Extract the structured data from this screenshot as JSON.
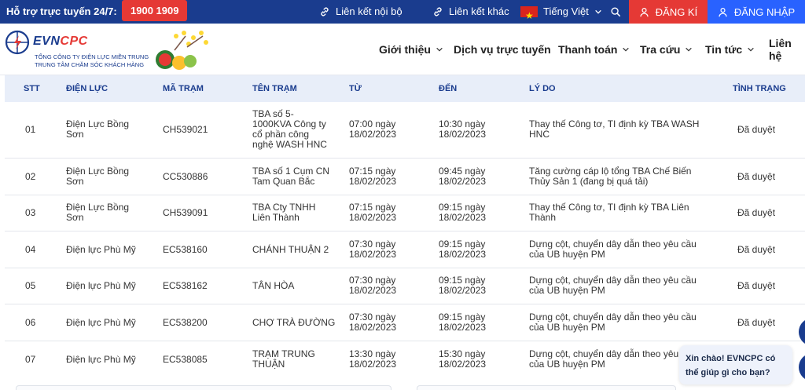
{
  "topbar": {
    "support_label": "Hỗ trợ trực tuyến 24/7:",
    "hotline": "1900 1909",
    "link_internal": "Liên kết nội bộ",
    "link_other": "Liên kết khác",
    "language": "Tiếng Việt",
    "register": "ĐĂNG KÍ",
    "login": "ĐĂNG NHẬP"
  },
  "brand": {
    "logo_ev": "EVN",
    "logo_cpc": "CPC",
    "sub1": "TỔNG CÔNG TY ĐIỆN LỰC MIỀN TRUNG",
    "sub2": "TRUNG TÂM CHĂM SÓC KHÁCH HÀNG"
  },
  "nav": {
    "intro": "Giới thiệu",
    "online": "Dịch vụ trực tuyến",
    "payment": "Thanh toán",
    "lookup": "Tra cứu",
    "news": "Tin tức",
    "contact": "Liên hệ"
  },
  "table": {
    "headers": {
      "stt": "STT",
      "dienluc": "ĐIỆN LỰC",
      "matram": "MÃ TRẠM",
      "tentram": "TÊN TRẠM",
      "tu": "TỪ",
      "den": "ĐẾN",
      "lydo": "LÝ DO",
      "tinhtrang": "TÌNH TRẠNG"
    },
    "rows": [
      {
        "stt": "01",
        "dl1": "Điện Lực Bồng",
        "dl2": "Sơn",
        "ma": "CH539021",
        "ten1": "TBA số 5-",
        "ten2": "1000KVA Công ty",
        "ten3": "cổ phần công",
        "ten4": "nghệ WASH HNC",
        "tu1": "07:00 ngày",
        "tu2": "18/02/2023",
        "den1": "10:30 ngày",
        "den2": "18/02/2023",
        "ly1": "Thay thế Công tơ, TI định kỳ TBA WASH",
        "ly2": "HNC",
        "tt": "Đã duyệt"
      },
      {
        "stt": "02",
        "dl1": "Điện Lực Bồng",
        "dl2": "Sơn",
        "ma": "CC530886",
        "ten1": "TBA số 1 Cụm CN",
        "ten2": "Tam Quan Bắc",
        "ten3": "",
        "ten4": "",
        "tu1": "07:15 ngày",
        "tu2": "18/02/2023",
        "den1": "09:45 ngày",
        "den2": "18/02/2023",
        "ly1": "Tăng cường cáp lộ tổng TBA Chế Biến",
        "ly2": "Thủy Sản 1 (đang bị quá tải)",
        "tt": "Đã duyệt"
      },
      {
        "stt": "03",
        "dl1": "Điện Lực Bồng",
        "dl2": "Sơn",
        "ma": "CH539091",
        "ten1": "TBA Cty TNHH",
        "ten2": "Liên Thành",
        "ten3": "",
        "ten4": "",
        "tu1": "07:15 ngày",
        "tu2": "18/02/2023",
        "den1": "09:15 ngày",
        "den2": "18/02/2023",
        "ly1": "Thay thế Công tơ, TI định kỳ TBA Liên",
        "ly2": "Thành",
        "tt": "Đã duyệt"
      },
      {
        "stt": "04",
        "dl1": "Điện lực Phù Mỹ",
        "dl2": "",
        "ma": "EC538160",
        "ten1": "CHÁNH THUẬN 2",
        "ten2": "",
        "ten3": "",
        "ten4": "",
        "tu1": "07:30 ngày",
        "tu2": "18/02/2023",
        "den1": "09:15 ngày",
        "den2": "18/02/2023",
        "ly1": "Dựng cột, chuyển dây dẫn theo yêu cầu",
        "ly2": "của UB huyện PM",
        "tt": "Đã duyệt"
      },
      {
        "stt": "05",
        "dl1": "Điện lực Phù Mỹ",
        "dl2": "",
        "ma": "EC538162",
        "ten1": "TÂN HÒA",
        "ten2": "",
        "ten3": "",
        "ten4": "",
        "tu1": "07:30 ngày",
        "tu2": "18/02/2023",
        "den1": "09:15 ngày",
        "den2": "18/02/2023",
        "ly1": "Dựng cột, chuyển dây dẫn theo yêu cầu",
        "ly2": "của UB huyện PM",
        "tt": "Đã duyệt"
      },
      {
        "stt": "06",
        "dl1": "Điện lực Phù Mỹ",
        "dl2": "",
        "ma": "EC538200",
        "ten1": "CHỢ TRÀ ĐƯỜNG",
        "ten2": "",
        "ten3": "",
        "ten4": "",
        "tu1": "07:30 ngày",
        "tu2": "18/02/2023",
        "den1": "09:15 ngày",
        "den2": "18/02/2023",
        "ly1": "Dựng cột, chuyển dây dẫn theo yêu cầu",
        "ly2": "của UB huyện PM",
        "tt": "Đã duyệt"
      },
      {
        "stt": "07",
        "dl1": "Điện lực Phù Mỹ",
        "dl2": "",
        "ma": "EC538085",
        "ten1": "TRẠM TRUNG",
        "ten2": "THUẬN",
        "ten3": "",
        "ten4": "",
        "tu1": "13:30 ngày",
        "tu2": "18/02/2023",
        "den1": "15:30 ngày",
        "den2": "18/02/2023",
        "ly1": "Dựng cột, chuyển dây dẫn theo yêu cầu",
        "ly2": "của UB huyện PM",
        "tt": "Đã duyệt"
      }
    ]
  },
  "chat": {
    "line1": "Xin chào! EVNCPC có",
    "line2": "thể giúp gì cho bạn?"
  },
  "colors": {
    "primary": "#1a3c8e",
    "accent": "#e53935",
    "login": "#2962ff"
  }
}
